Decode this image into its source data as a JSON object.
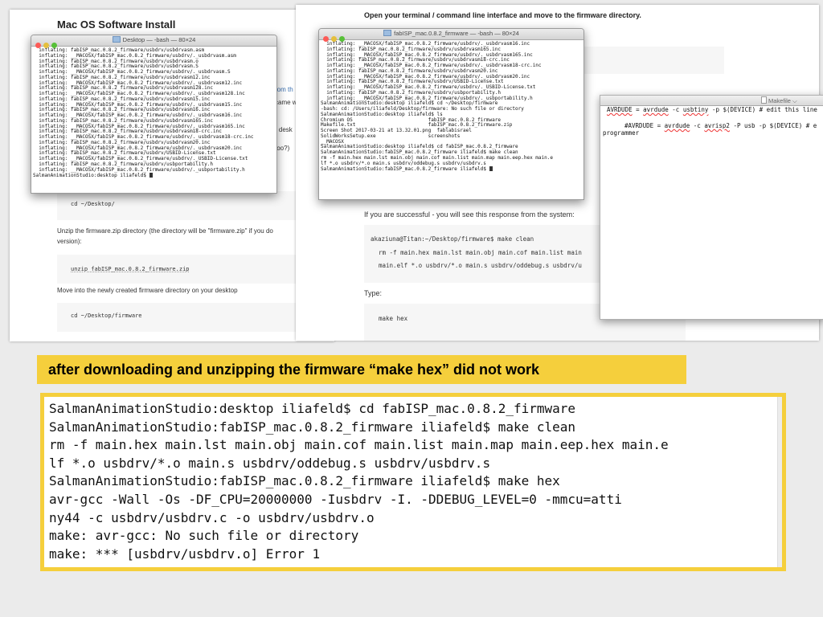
{
  "left_page": {
    "heading": "Mac OS Software Install",
    "frag1": "rom th",
    "frag2": "came w",
    "frag3": "r desk",
    "frag4": "too?)",
    "cd_desktop": "cd ~/Desktop/",
    "unzip_text": "Unzip the firmware.zip directory (the directory will be \"firmware.zip\" if you do",
    "version_text": "version):",
    "unzip_cmd": "unzip fabISP_mac.0.8.2_firmware.zip",
    "move_text": "Move into the newly created firmware directory on your desktop",
    "cd_firmware": "cd ~/Desktop/firmware"
  },
  "desktop_terminal": {
    "title": "Desktop — -bash — 80×24",
    "lines": [
      "  inflating: fabISP_mac.0.8.2_firmware/usbdrv/usbdrvasm.asm",
      "  inflating: __MACOSX/fabISP_mac.0.8.2_firmware/usbdrv/._usbdrvasm.asm",
      "  inflating: fabISP_mac.0.8.2_firmware/usbdrv/usbdrvasm.o",
      "  inflating: fabISP_mac.0.8.2_firmware/usbdrv/usbdrvasm.S",
      "  inflating: __MACOSX/fabISP_mac.0.8.2_firmware/usbdrv/._usbdrvasm.S",
      "  inflating: fabISP_mac.0.8.2_firmware/usbdrv/usbdrvasm12.inc",
      "  inflating: __MACOSX/fabISP_mac.0.8.2_firmware/usbdrv/._usbdrvasm12.inc",
      "  inflating: fabISP_mac.0.8.2_firmware/usbdrv/usbdrvasm128.inc",
      "  inflating: __MACOSX/fabISP_mac.0.8.2_firmware/usbdrv/._usbdrvasm128.inc",
      "  inflating: fabISP_mac.0.8.2_firmware/usbdrv/usbdrvasm15.inc",
      "  inflating: __MACOSX/fabISP_mac.0.8.2_firmware/usbdrv/._usbdrvasm15.inc",
      "  inflating: fabISP_mac.0.8.2_firmware/usbdrv/usbdrvasm16.inc",
      "  inflating: __MACOSX/fabISP_mac.0.8.2_firmware/usbdrv/._usbdrvasm16.inc",
      "  inflating: fabISP_mac.0.8.2_firmware/usbdrv/usbdrvasm165.inc",
      "  inflating: __MACOSX/fabISP_mac.0.8.2_firmware/usbdrv/._usbdrvasm165.inc",
      "  inflating: fabISP_mac.0.8.2_firmware/usbdrv/usbdrvasm18-crc.inc",
      "  inflating: __MACOSX/fabISP_mac.0.8.2_firmware/usbdrv/._usbdrvasm18-crc.inc",
      "  inflating: fabISP_mac.0.8.2_firmware/usbdrv/usbdrvasm20.inc",
      "  inflating: __MACOSX/fabISP_mac.0.8.2_firmware/usbdrv/._usbdrvasm20.inc",
      "  inflating: fabISP_mac.0.8.2_firmware/usbdrv/USBID-License.txt",
      "  inflating: __MACOSX/fabISP_mac.0.8.2_firmware/usbdrv/._USBID-License.txt",
      "  inflating: fabISP_mac.0.8.2_firmware/usbdrv/usbportability.h",
      "  inflating: __MACOSX/fabISP_mac.0.8.2_firmware/usbdrv/._usbportability.h",
      "SalmanAnimationStudio:desktop iliafeld$ "
    ]
  },
  "fabisp_terminal": {
    "title": "fabISP_mac.0.8.2_firmware — -bash — 80×24",
    "lines": [
      "  inflating: __MACOSX/fabISP_mac.0.8.2_firmware/usbdrv/._usbdrvasm16.inc",
      "  inflating: fabISP_mac.0.8.2_firmware/usbdrv/usbdrvasm165.inc",
      "  inflating: __MACOSX/fabISP_mac.0.8.2_firmware/usbdrv/._usbdrvasm165.inc",
      "  inflating: fabISP_mac.0.8.2_firmware/usbdrv/usbdrvasm18-crc.inc",
      "  inflating: __MACOSX/fabISP_mac.0.8.2_firmware/usbdrv/._usbdrvasm18-crc.inc",
      "  inflating: fabISP_mac.0.8.2_firmware/usbdrv/usbdrvasm20.inc",
      "  inflating: __MACOSX/fabISP_mac.0.8.2_firmware/usbdrv/._usbdrvasm20.inc",
      "  inflating: fabISP_mac.0.8.2_firmware/usbdrv/USBID-License.txt",
      "  inflating: __MACOSX/fabISP_mac.0.8.2_firmware/usbdrv/._USBID-License.txt",
      "  inflating: fabISP_mac.0.8.2_firmware/usbdrv/usbportability.h",
      "  inflating: __MACOSX/fabISP_mac.0.8.2_firmware/usbdrv/._usbportability.h",
      "SalmanAnimationStudio:desktop iliafeld$ cd ~/Desktop/firmware",
      "-bash: cd: /Users/iliafeld/Desktop/firmware: No such file or directory",
      "SalmanAnimationStudio:desktop iliafeld$ ls",
      "Chromium OS                          fabISP_mac.0.8.2_firmware",
      "Makefile.txt                         fabISP_mac.0.8.2_firmware.zip",
      "Screen Shot 2017-03-21 at 13.32.01.png  fablabisrael",
      "SolidWorksSetup.exe                  screenshots",
      "__MACOSX",
      "SalmanAnimationStudio:desktop iliafeld$ cd fabISP_mac.0.8.2_firmware",
      "SalmanAnimationStudio:fabISP_mac.0.8.2_firmware iliafeld$ make clean",
      "rm -f main.hex main.lst main.obj main.cof main.list main.map main.eep.hex main.e",
      "lf *.o usbdrv/*.o main.s usbdrv/oddebug.s usbdrv/usbdrv.s",
      "SalmanAnimationStudio:fabISP_mac.0.8.2_firmware iliafeld$ "
    ]
  },
  "right_page": {
    "instruction": "Open your terminal / command line interface and move to the firmware directory.",
    "success_text": "If you are successful - you will see this response from the system:",
    "term_prompt": "akaziuna@Titan:~/Desktop/firmware$ make clean",
    "term_line1": "rm -f main.hex main.lst main.obj main.cof main.list main",
    "term_line2": "main.elf *.o usbdrv/*.o main.s usbdrv/oddebug.s usbdrv/u",
    "type_label": "Type:",
    "make_hex": "make hex"
  },
  "makefile_window": {
    "title": "Makefile",
    "line1_a": "AVRDUDE",
    "line1_b": " = ",
    "line1_c": "avrdude",
    "line1_d": " -c ",
    "line1_e": "usbtiny",
    "line1_f": " -p $(DEVICE) # edit this line",
    "line2_a": "#AVRDUDE = ",
    "line2_b": "avrdude",
    "line2_c": " -c ",
    "line2_d": "avrisp2",
    "line2_e": " -P usb -p $(DEVICE) # e",
    "line3": "programmer"
  },
  "caption": "after downloading and unzipping the firmware “make hex” did not work",
  "zoom_terminal": {
    "lines": [
      "SalmanAnimationStudio:desktop iliafeld$ cd fabISP_mac.0.8.2_firmware",
      "SalmanAnimationStudio:fabISP_mac.0.8.2_firmware iliafeld$ make clean",
      "rm -f main.hex main.lst main.obj main.cof main.list main.map main.eep.hex main.e",
      "lf *.o usbdrv/*.o main.s usbdrv/oddebug.s usbdrv/usbdrv.s",
      "SalmanAnimationStudio:fabISP_mac.0.8.2_firmware iliafeld$ make hex",
      "avr-gcc -Wall -Os -DF_CPU=20000000       -Iusbdrv -I. -DDEBUG_LEVEL=0 -mmcu=atti",
      "ny44 -c usbdrv/usbdrv.c -o usbdrv/usbdrv.o",
      "make: avr-gcc: No such file or directory",
      "make: *** [usbdrv/usbdrv.o] Error 1"
    ]
  },
  "colors": {
    "caption_bg": "#f5cf3c",
    "traffic_red": "#fc5b57",
    "traffic_yellow": "#e5bf3c",
    "traffic_green": "#57c038"
  }
}
